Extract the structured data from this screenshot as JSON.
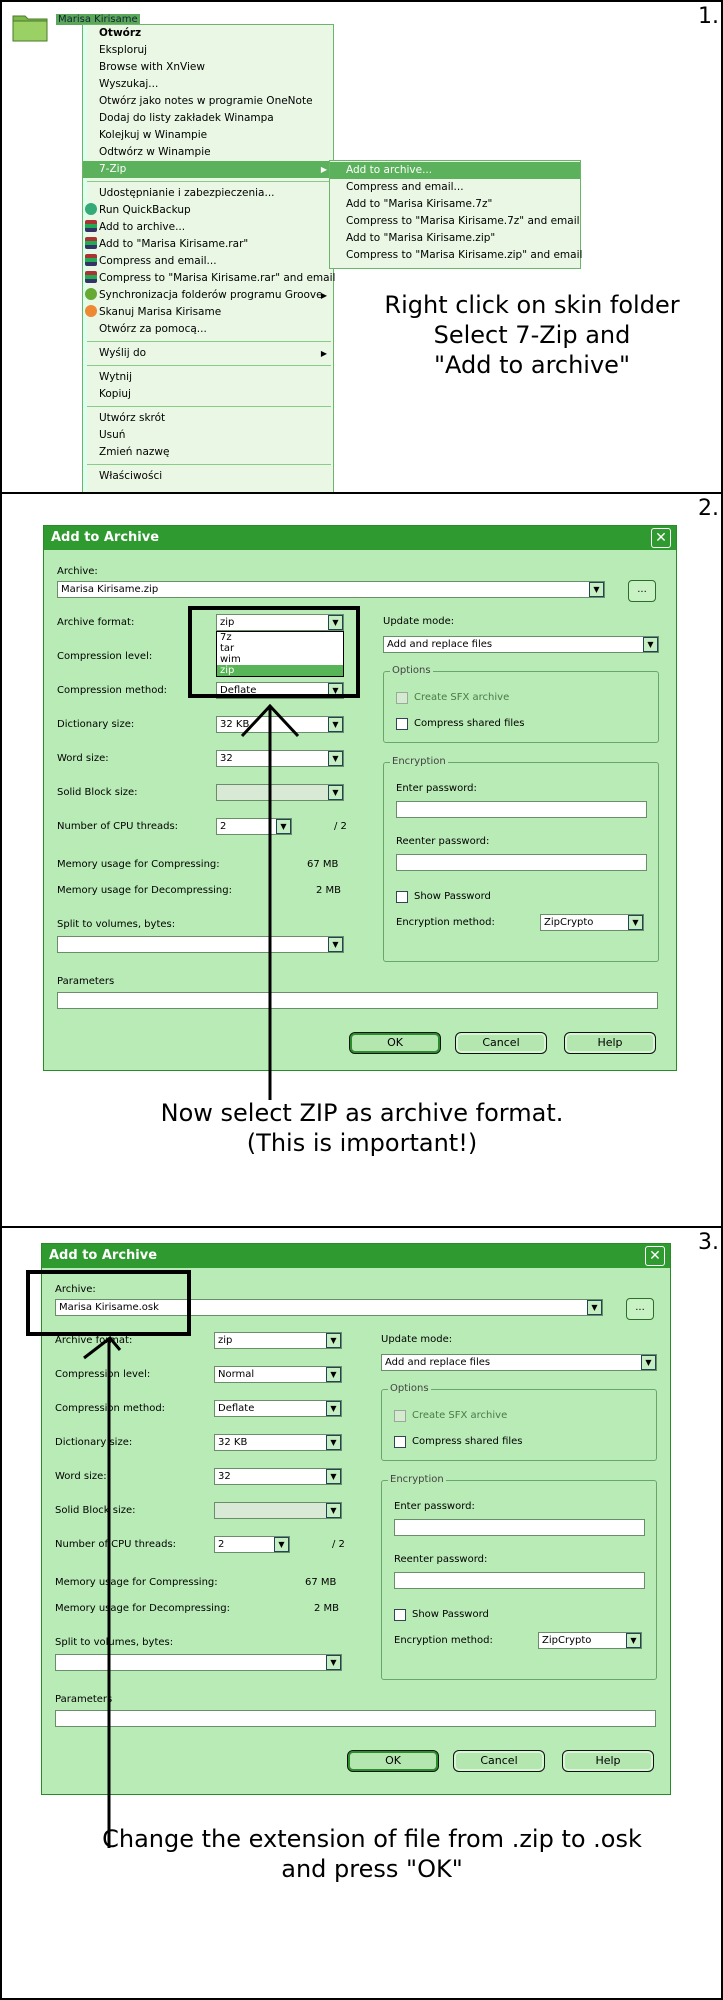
{
  "step1": {
    "number": "1.",
    "folder_label": "Marisa Kirisame",
    "menu": [
      {
        "label": "Otwórz",
        "bold": true
      },
      {
        "label": "Eksploruj"
      },
      {
        "label": "Browse with XnView"
      },
      {
        "label": "Wyszukaj..."
      },
      {
        "label": "Otwórz jako notes w programie OneNote"
      },
      {
        "label": "Dodaj do listy zakładek Winampa"
      },
      {
        "label": "Kolejkuj w Winampie"
      },
      {
        "label": "Odtwórz w Winampie"
      },
      {
        "label": "7-Zip",
        "submenu": true,
        "highlight": true
      },
      {
        "sep": true
      },
      {
        "label": "Udostępnianie i zabezpieczenia..."
      },
      {
        "label": "Run QuickBackup",
        "icon": "qb"
      },
      {
        "label": "Add to archive...",
        "icon": "rar"
      },
      {
        "label": "Add to \"Marisa Kirisame.rar\"",
        "icon": "rar"
      },
      {
        "label": "Compress and email...",
        "icon": "rar"
      },
      {
        "label": "Compress to \"Marisa Kirisame.rar\" and email",
        "icon": "rar"
      },
      {
        "label": "Synchronizacja folderów programu Groove",
        "icon": "gr",
        "submenu": true
      },
      {
        "label": "Skanuj Marisa Kirisame",
        "icon": "sk"
      },
      {
        "label": "Otwórz za pomocą..."
      },
      {
        "sep": true
      },
      {
        "label": "Wyślij do",
        "submenu": true
      },
      {
        "sep": true
      },
      {
        "label": "Wytnij"
      },
      {
        "label": "Kopiuj"
      },
      {
        "sep": true
      },
      {
        "label": "Utwórz skrót"
      },
      {
        "label": "Usuń"
      },
      {
        "label": "Zmień nazwę"
      },
      {
        "sep": true
      },
      {
        "label": "Właściwości"
      }
    ],
    "submenu": [
      {
        "label": "Add to archive...",
        "highlight": true
      },
      {
        "label": "Compress and email..."
      },
      {
        "label": "Add to \"Marisa Kirisame.7z\""
      },
      {
        "label": "Compress to \"Marisa Kirisame.7z\" and email"
      },
      {
        "label": "Add to \"Marisa Kirisame.zip\""
      },
      {
        "label": "Compress to \"Marisa Kirisame.zip\" and email"
      }
    ],
    "instruction": [
      "Right click on skin folder",
      "Select 7-Zip and",
      "\"Add to archive\""
    ]
  },
  "dialog_common": {
    "title": "Add to Archive",
    "close": "✕",
    "archive_label": "Archive:",
    "browse": "...",
    "format_label": "Archive format:",
    "level_label": "Compression level:",
    "method_label": "Compression method:",
    "dict_label": "Dictionary size:",
    "word_label": "Word size:",
    "solid_label": "Solid Block size:",
    "threads_label": "Number of CPU threads:",
    "threads_value": "2",
    "threads_max": "/ 2",
    "mem_comp_label": "Memory usage for Compressing:",
    "mem_comp": "67 MB",
    "mem_decomp_label": "Memory usage for Decompressing:",
    "mem_decomp": "2 MB",
    "split_label": "Split to volumes, bytes:",
    "params_label": "Parameters",
    "update_label": "Update mode:",
    "update_value": "Add and replace files",
    "options_title": "Options",
    "sfx_label": "Create SFX archive",
    "shared_label": "Compress shared files",
    "enc_title": "Encryption",
    "enter_pw": "Enter password:",
    "reenter_pw": "Reenter password:",
    "show_pw": "Show Password",
    "enc_method_label": "Encryption method:",
    "enc_method": "ZipCrypto",
    "ok": "OK",
    "cancel": "Cancel",
    "help": "Help"
  },
  "step2": {
    "number": "2.",
    "archive": "Marisa Kirisame.zip",
    "format": "zip",
    "format_options": [
      "7z",
      "tar",
      "wim",
      "zip"
    ],
    "method_partial": "Deflate",
    "dict": "32 KB",
    "word": "32",
    "instruction": [
      "Now select  ZIP as archive format.",
      "(This is important!)"
    ]
  },
  "step3": {
    "number": "3.",
    "archive": "Marisa Kirisame.osk",
    "format": "zip",
    "level": "Normal",
    "method": "Deflate",
    "dict": "32 KB",
    "word": "32",
    "instruction": [
      "Change the extension of file from .zip to .osk",
      "and press \"OK\""
    ]
  }
}
